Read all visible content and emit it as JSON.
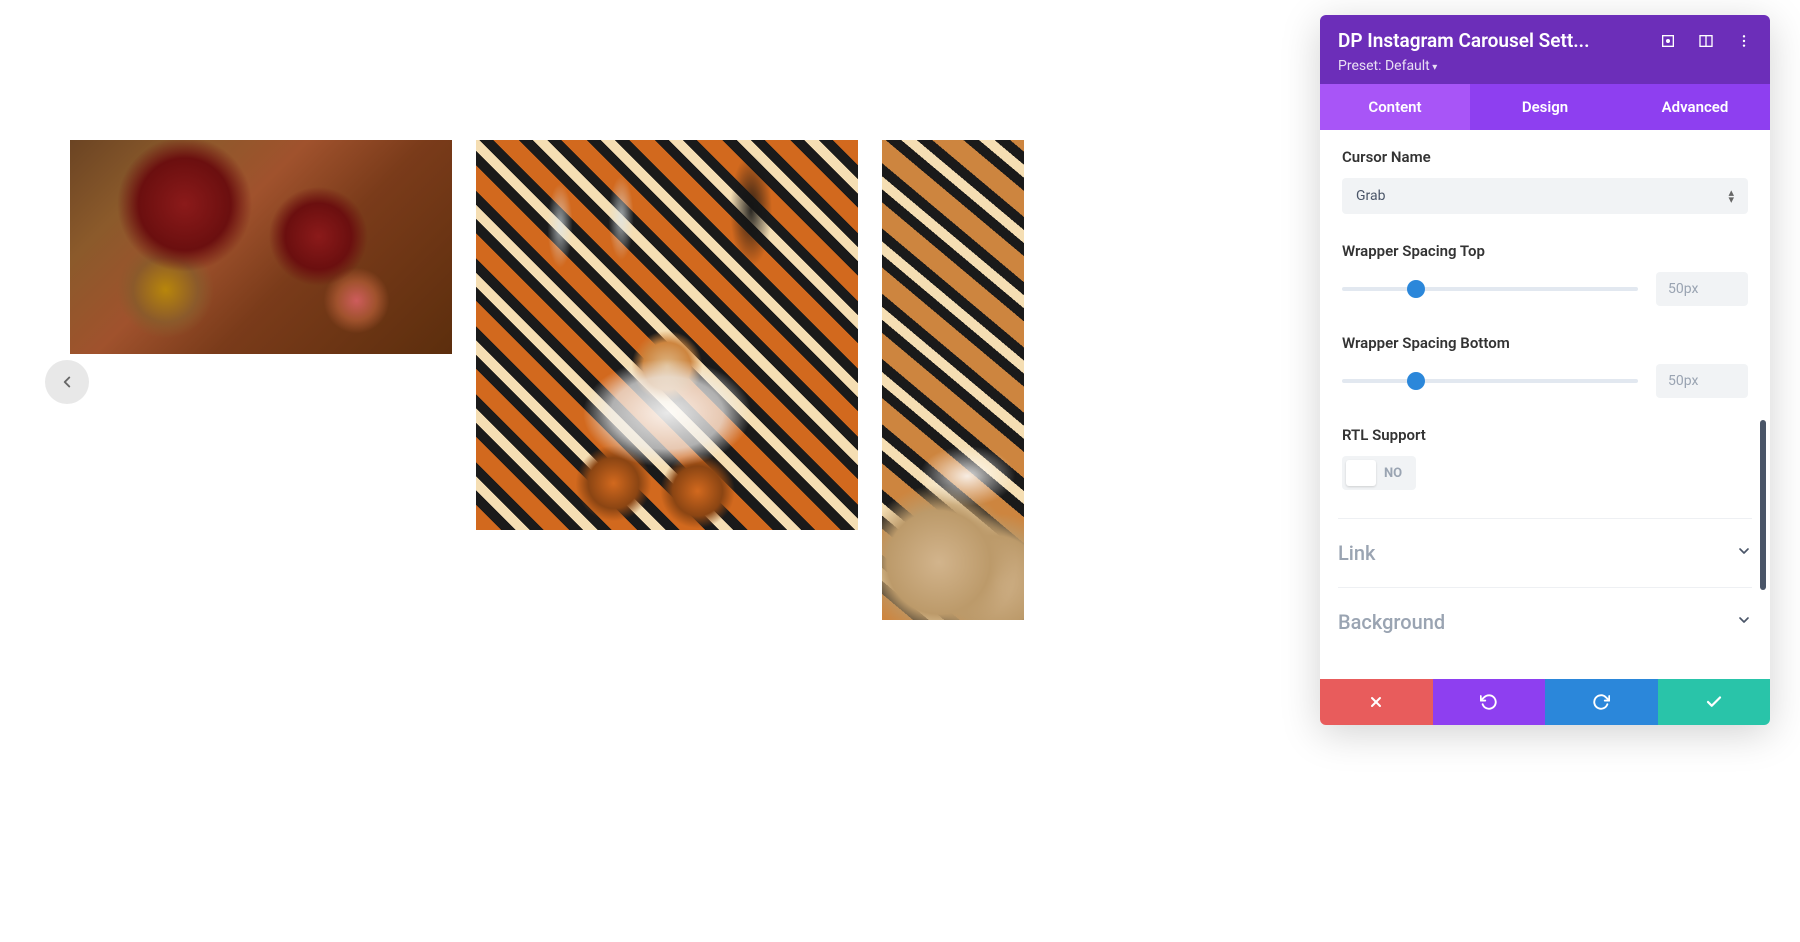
{
  "panel": {
    "title": "DP Instagram Carousel Sett...",
    "preset_label": "Preset: Default",
    "tabs": {
      "content": "Content",
      "design": "Design",
      "advanced": "Advanced"
    }
  },
  "fields": {
    "cursor_name": {
      "label": "Cursor Name",
      "value": "Grab"
    },
    "wrapper_top": {
      "label": "Wrapper Spacing Top",
      "value": "50px",
      "percent": 25
    },
    "wrapper_bottom": {
      "label": "Wrapper Spacing Bottom",
      "value": "50px",
      "percent": 25
    },
    "rtl": {
      "label": "RTL Support",
      "state": "NO"
    }
  },
  "sections": {
    "link": "Link",
    "background": "Background"
  }
}
